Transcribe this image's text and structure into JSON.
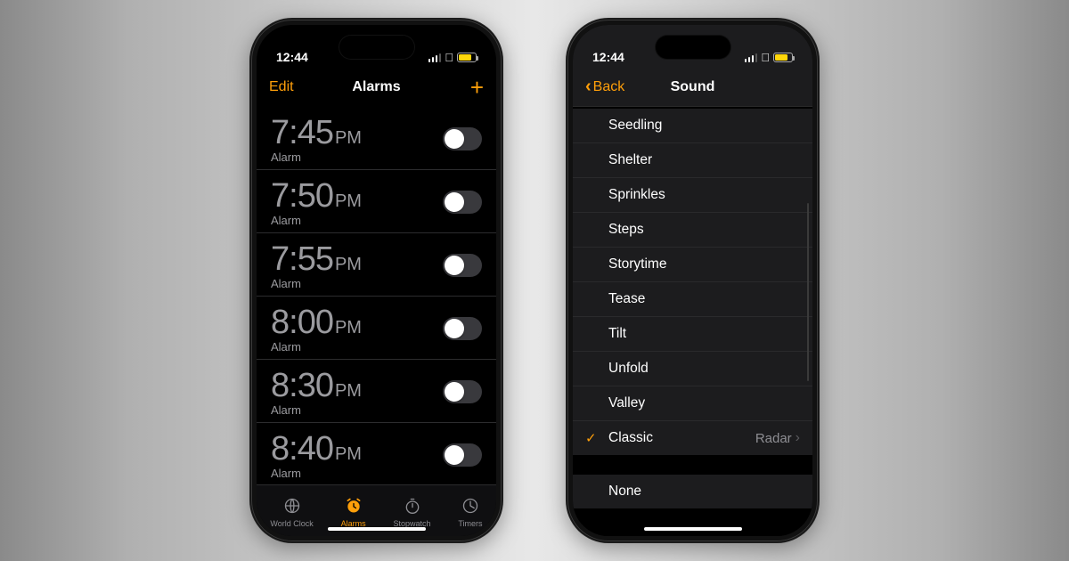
{
  "status": {
    "time": "12:44"
  },
  "phone1": {
    "nav": {
      "edit": "Edit",
      "title": "Alarms",
      "add": "+"
    },
    "alarms": [
      {
        "time": "7:45",
        "meridiem": "PM",
        "label": "Alarm"
      },
      {
        "time": "7:50",
        "meridiem": "PM",
        "label": "Alarm"
      },
      {
        "time": "7:55",
        "meridiem": "PM",
        "label": "Alarm"
      },
      {
        "time": "8:00",
        "meridiem": "PM",
        "label": "Alarm"
      },
      {
        "time": "8:30",
        "meridiem": "PM",
        "label": "Alarm"
      },
      {
        "time": "8:40",
        "meridiem": "PM",
        "label": "Alarm"
      }
    ],
    "tabs": [
      {
        "label": "World Clock"
      },
      {
        "label": "Alarms"
      },
      {
        "label": "Stopwatch"
      },
      {
        "label": "Timers"
      }
    ]
  },
  "phone2": {
    "nav": {
      "back": "Back",
      "title": "Sound"
    },
    "sounds": [
      {
        "name": "Seedling"
      },
      {
        "name": "Shelter"
      },
      {
        "name": "Sprinkles"
      },
      {
        "name": "Steps"
      },
      {
        "name": "Storytime"
      },
      {
        "name": "Tease"
      },
      {
        "name": "Tilt"
      },
      {
        "name": "Unfold"
      },
      {
        "name": "Valley"
      }
    ],
    "classic": {
      "name": "Classic",
      "detail": "Radar",
      "checked": true
    },
    "none": {
      "name": "None"
    }
  }
}
